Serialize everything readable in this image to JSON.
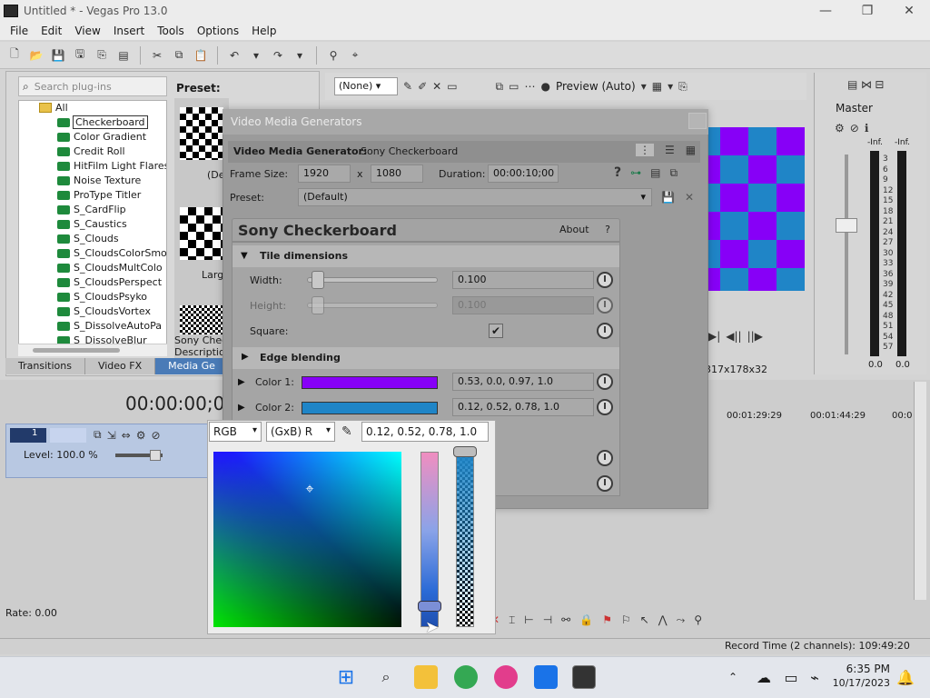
{
  "window": {
    "title": "Untitled * - Vegas Pro 13.0"
  },
  "menu": [
    "File",
    "Edit",
    "View",
    "Insert",
    "Tools",
    "Options",
    "Help"
  ],
  "plugins": {
    "search_placeholder": "Search plug-ins",
    "root": "All",
    "items": [
      "Checkerboard",
      "Color Gradient",
      "Credit Roll",
      "HitFilm Light Flares",
      "Noise Texture",
      "ProType Titler",
      "S_CardFlip",
      "S_Caustics",
      "S_Clouds",
      "S_CloudsColorSmo",
      "S_CloudsMultColo",
      "S_CloudsPerspect",
      "S_CloudsPsyko",
      "S_CloudsVortex",
      "S_DissolveAutoPa",
      "S_DissolveBlur"
    ],
    "selected": "Checkerboard",
    "preset_label": "Preset:",
    "thumb1_label": "(De",
    "thumb2_label": "Larg",
    "desc_line1": "Sony Check",
    "desc_line2": "Description"
  },
  "tabs": [
    "Transitions",
    "Video FX",
    "Media Ge"
  ],
  "trimmer": {
    "none_option": "(None)",
    "preview_label": "Preview (Auto)"
  },
  "preview": {
    "res_label": "317x178x32",
    "colors": {
      "blue": "#1f85c7",
      "purple": "#8700f7"
    }
  },
  "master": {
    "title": "Master",
    "inf_l": "-Inf.",
    "inf_r": "-Inf.",
    "scale": [
      "3",
      "6",
      "9",
      "12",
      "15",
      "18",
      "21",
      "24",
      "27",
      "30",
      "33",
      "36",
      "39",
      "42",
      "45",
      "48",
      "51",
      "54",
      "57"
    ],
    "val_l": "0.0",
    "val_r": "0.0"
  },
  "timeline": {
    "time": "00:00:00;00",
    "level": "Level: 100.0 %",
    "rate": "Rate: 0.00",
    "ruler": [
      "00:01:29:29",
      "00:01:44:29",
      "00:0"
    ],
    "record_time": "Record Time (2 channels): 109:49:20",
    "track_num": "1"
  },
  "dialog": {
    "title": "Video Media Generators",
    "generator_label": "Video Media Generator:",
    "generator_value": "Sony Checkerboard",
    "frame_size_label": "Frame Size:",
    "width": "1920",
    "x_label": "x",
    "height": "1080",
    "duration_label": "Duration:",
    "duration": "00:00:10;00",
    "preset_label": "Preset:",
    "preset_value": "(Default)",
    "plugin_title": "Sony Checkerboard",
    "about": "About",
    "help": "?",
    "tile_section": "Tile dimensions",
    "width_label": "Width:",
    "width_value": "0.100",
    "height_label": "Height:",
    "height_value": "0.100",
    "square_label": "Square:",
    "edge_section": "Edge blending",
    "color1_label": "Color 1:",
    "color1_value": "0.53, 0.0, 0.97, 1.0",
    "color2_label": "Color 2:",
    "color2_value": "0.12, 0.52, 0.78, 1.0",
    "colors": {
      "color1": "#8700f7",
      "color2": "#1f85c7"
    }
  },
  "picker": {
    "mode": "RGB",
    "axis": "(GxB) R",
    "value": "0.12, 0.52, 0.78, 1.0"
  },
  "taskbar": {
    "time": "6:35 PM",
    "date": "10/17/2023"
  }
}
